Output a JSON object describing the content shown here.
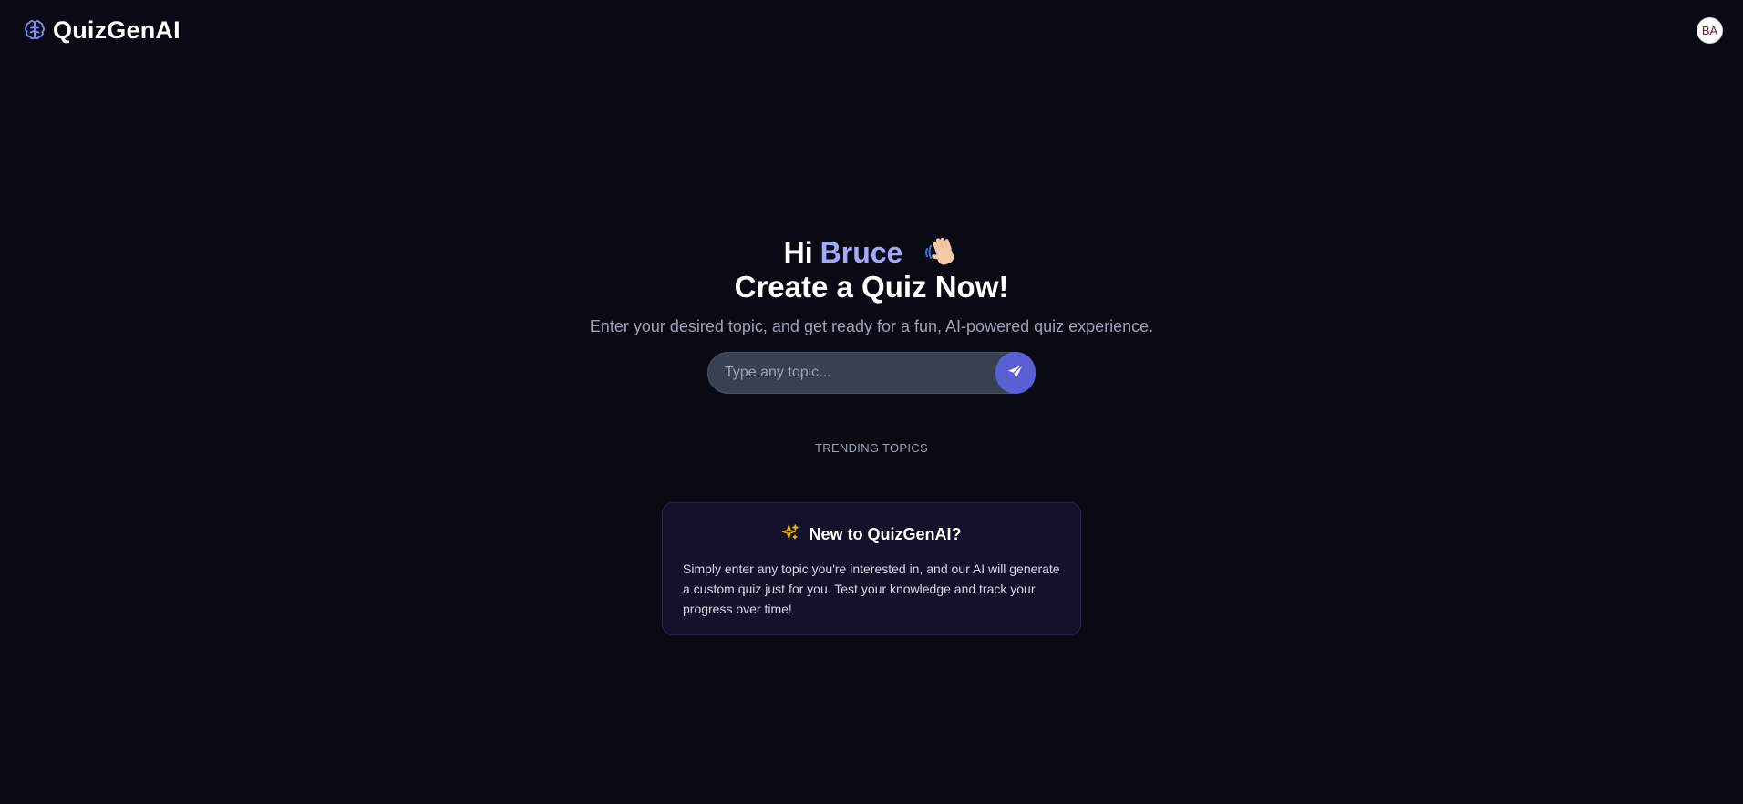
{
  "header": {
    "brand_name": "QuizGenAI",
    "brand_icon": "brain-icon",
    "avatar_initials": "BA"
  },
  "hero": {
    "greeting_prefix": "Hi",
    "user_name": "Bruce",
    "wave_icon": "waving-hand-icon",
    "title": "Create a Quiz Now!",
    "subtitle": "Enter your desired topic, and get ready for a fun, AI-powered quiz experience."
  },
  "search": {
    "placeholder": "Type any topic...",
    "value": "",
    "send_icon": "send-icon"
  },
  "trending": {
    "label": "TRENDING TOPICS"
  },
  "info_card": {
    "icon": "sparkles-icon",
    "title": "New to QuizGenAI?",
    "body": "Simply enter any topic you're interested in, and our AI will generate a custom quiz just for you. Test your knowledge and track your progress over time!"
  },
  "colors": {
    "background": "#0a0a14",
    "accent": "#5b5fd6",
    "name_highlight": "#a5a8ff",
    "sparkle": "#f5b400",
    "brain": "#7c8cf8"
  }
}
